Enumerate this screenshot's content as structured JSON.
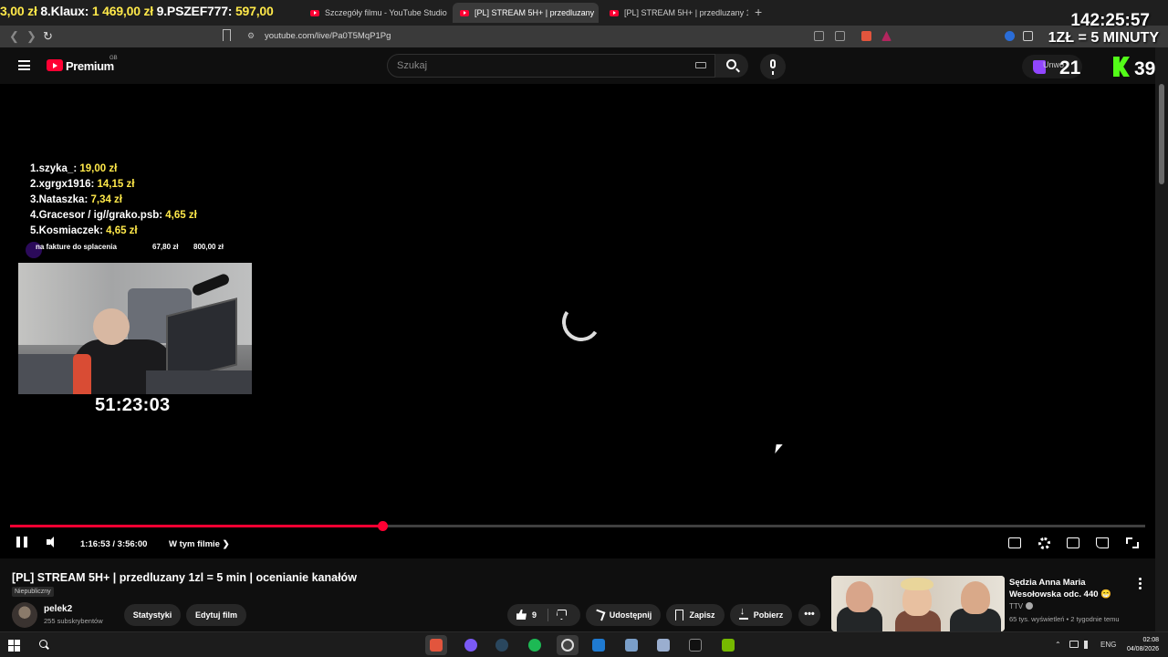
{
  "ticker": {
    "part1_text": "3,00 zł",
    "part2_text": " 8.Klaux: ",
    "part2_amt": "1 469,00 zł",
    "part3_text": " 9.PSZEF777: ",
    "part3_amt": "597,00"
  },
  "tabs": [
    {
      "label": "Szczegóły filmu - YouTube Studio"
    },
    {
      "label": "[PL] STREAM 5H+ | przedluzany"
    },
    {
      "label": "[PL] STREAM 5H+ | przedluzany 1zł"
    }
  ],
  "tab_close": "✕",
  "new_tab": "+",
  "overlay": {
    "clock": "142:25:57",
    "rule": "1ZŁ = 5 MINUTY"
  },
  "address": {
    "back": "❮",
    "forward": "❯",
    "reload": "↻",
    "site_info": "⚙",
    "url": "youtube.com/live/Pa0T5MqP1Pg"
  },
  "header": {
    "brand": "Premium",
    "region": "GB",
    "search_placeholder": "Szukaj",
    "twitch_label": "Unwo",
    "twitch_count": "21",
    "kick_count": "39"
  },
  "leaderboard": [
    {
      "name": "1.szyka_: ",
      "amount": "19,00 zł"
    },
    {
      "name": "2.xgrgx1916: ",
      "amount": "14,15 zł"
    },
    {
      "name": "3.Nataszka: ",
      "amount": "7,34 zł"
    },
    {
      "name": "4.Gracesor / ig//grako.psb: ",
      "amount": "4,65 zł"
    },
    {
      "name": "5.Kosmiaczek: ",
      "amount": "4,65 zł"
    }
  ],
  "goal": {
    "label": "na fakture do splacenia",
    "current": "67,80 zł",
    "target": "800,00 zł"
  },
  "stream_timer": "51:23:03",
  "player": {
    "progress_fraction": 0.328,
    "time": "1:16:53 / 3:56:00",
    "chapter": "W tym filmie",
    "chapter_chevron": "❯"
  },
  "video": {
    "title": "[PL] STREAM 5H+ | przedluzany 1zl = 5 min | ocenianie kanałów",
    "visibility": "Niepubliczny",
    "channel": "pelek2",
    "subscribers": "255 subskrybentów",
    "stats_label": "Statystyki",
    "edit_label": "Edytuj film",
    "likes": "9",
    "share_label": "Udostępnij",
    "save_label": "Zapisz",
    "download_label": "Pobierz",
    "more": "•••"
  },
  "recommendation": {
    "title": "Sędzia Anna Maria Wesołowska odc. 440 😁",
    "channel": "TTV",
    "meta": "65 tys. wyświetleń • 2 tygodnie temu"
  },
  "taskbar": {
    "tray_chevron": "⌃",
    "tray_lang": "ENG",
    "time": "02:08",
    "date": "04/08/2026"
  },
  "colors": {
    "accent_red": "#ff0033",
    "donation_yellow": "#ffe94a",
    "twitch": "#9146ff",
    "kick": "#53fc18"
  }
}
